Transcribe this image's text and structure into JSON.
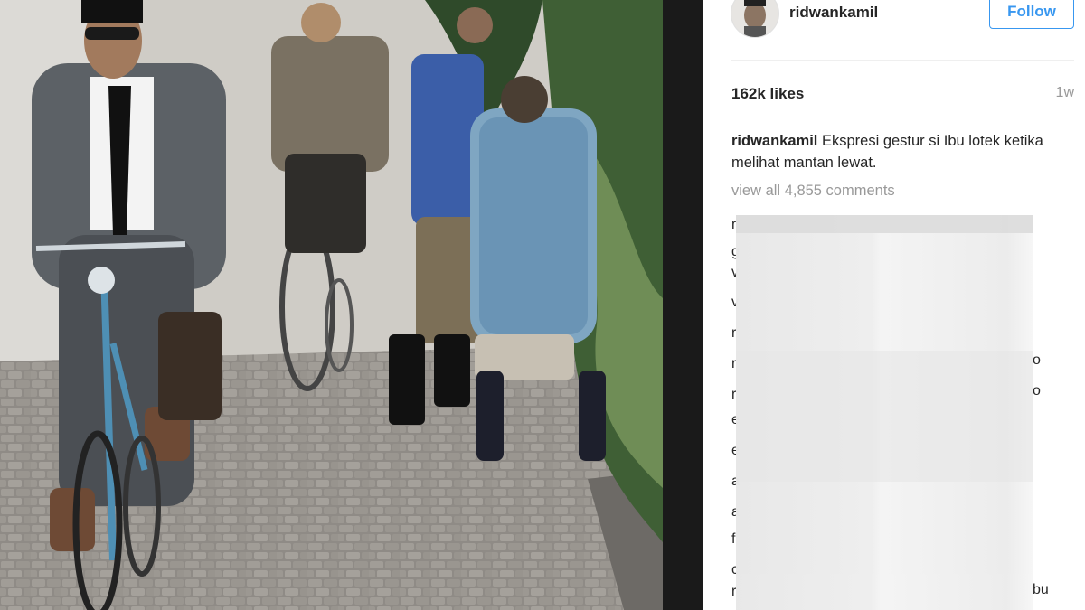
{
  "photo": {
    "description_icon": "photo-scene"
  },
  "post": {
    "username": "ridwankamil",
    "follow_label": "Follow",
    "likes": "162k likes",
    "time_ago": "1w",
    "caption_user": "ridwankamil",
    "caption_text": "Ekspresi gestur si Ibu lotek ketika melihat mantan lewat.",
    "view_all": "view all 4,855 comments",
    "accent_color": "#3897f0"
  },
  "comments": {
    "left_chars": [
      "r",
      "g",
      "v",
      "v",
      "r",
      "r",
      "r",
      "e",
      "e",
      "a",
      "a",
      "f",
      "c",
      "r"
    ],
    "right_chars": [
      "o",
      "o",
      "bu"
    ]
  }
}
